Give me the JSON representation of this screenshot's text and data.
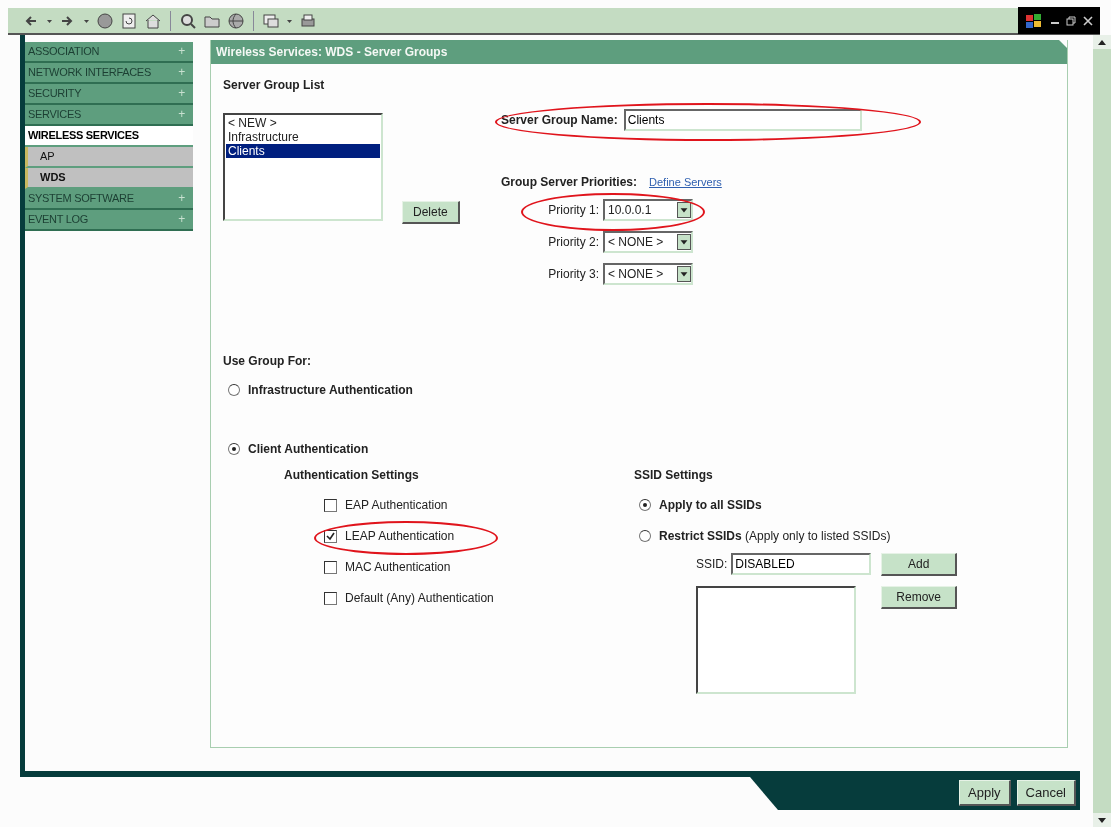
{
  "sidebar": {
    "items": [
      {
        "label": "ASSOCIATION",
        "expand": "+",
        "expanded": false,
        "selected": false
      },
      {
        "label": "NETWORK INTERFACES",
        "expand": "+",
        "expanded": false,
        "selected": false
      },
      {
        "label": "SECURITY",
        "expand": "+",
        "expanded": false,
        "selected": false
      },
      {
        "label": "SERVICES",
        "expand": "+",
        "expanded": false,
        "selected": false
      },
      {
        "label": "WIRELESS SERVICES",
        "expanded": true,
        "selected": false,
        "children": [
          {
            "label": "AP",
            "selected": false
          },
          {
            "label": "WDS",
            "selected": true
          }
        ]
      },
      {
        "label": "SYSTEM SOFTWARE",
        "expand": "+",
        "expanded": false,
        "selected": false
      },
      {
        "label": "EVENT LOG",
        "expand": "+",
        "expanded": false,
        "selected": false
      }
    ]
  },
  "panel": {
    "title": "Wireless Services: WDS - Server Groups"
  },
  "server_group_list": {
    "heading": "Server Group List",
    "items": [
      {
        "label": "< NEW >",
        "selected": false
      },
      {
        "label": "Infrastructure",
        "selected": false
      },
      {
        "label": "Clients",
        "selected": true
      }
    ],
    "delete_button": "Delete"
  },
  "server_group_name": {
    "label": "Server Group Name:",
    "value": "Clients",
    "highlighted": true
  },
  "group_server_priorities": {
    "heading": "Group Server Priorities:",
    "link": "Define Servers",
    "priorities": [
      {
        "label": "Priority 1:",
        "value": "10.0.0.1",
        "highlighted": true
      },
      {
        "label": "Priority 2:",
        "value": "< NONE >",
        "highlighted": false
      },
      {
        "label": "Priority 3:",
        "value": "< NONE >",
        "highlighted": false
      }
    ]
  },
  "use_group_for": {
    "heading": "Use Group For:",
    "options": [
      {
        "label": "Infrastructure Authentication",
        "selected": false
      },
      {
        "label": "Client Authentication",
        "selected": true
      }
    ]
  },
  "authentication_settings": {
    "heading": "Authentication Settings",
    "options": [
      {
        "label": "EAP Authentication",
        "checked": false,
        "highlighted": false
      },
      {
        "label": "LEAP Authentication",
        "checked": true,
        "highlighted": true
      },
      {
        "label": "MAC Authentication",
        "checked": false,
        "highlighted": false
      },
      {
        "label": "Default (Any) Authentication",
        "checked": false,
        "highlighted": false
      }
    ]
  },
  "ssid_settings": {
    "heading": "SSID Settings",
    "options": [
      {
        "label": "**Apply to all SSIDs**",
        "selected": true
      },
      {
        "label": "**Restrict SSIDs** (Apply only to listed SSIDs)",
        "selected": false
      }
    ],
    "ssid_field": {
      "label": "SSID:",
      "value": "DISABLED"
    },
    "add_button": "Add",
    "remove_button": "Remove"
  },
  "footer": {
    "buttons": [
      "Apply",
      "Cancel"
    ]
  }
}
